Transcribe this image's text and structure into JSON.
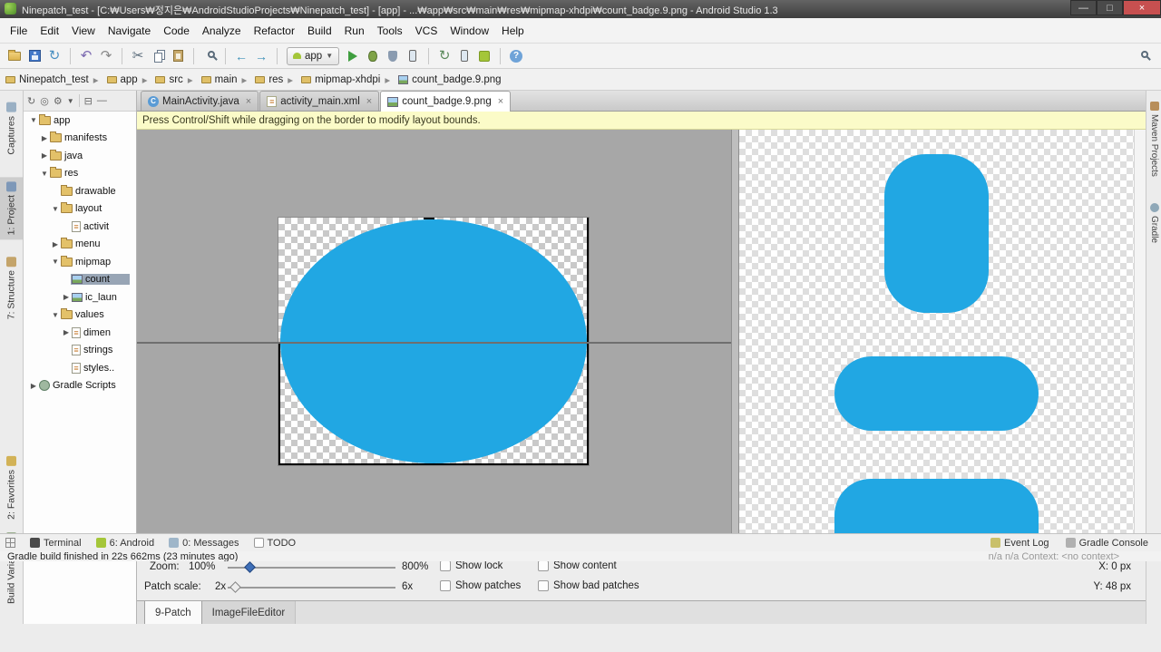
{
  "window": {
    "title": "Ninepatch_test - [C:₩Users₩정지은₩AndroidStudioProjects₩Ninepatch_test] - [app] - ...₩app₩src₩main₩res₩mipmap-xhdpi₩count_badge.9.png - Android Studio 1.3",
    "controls": {
      "minimize": "—",
      "maximize": "□",
      "close": "×"
    }
  },
  "menu": {
    "items": [
      "File",
      "Edit",
      "View",
      "Navigate",
      "Code",
      "Analyze",
      "Refactor",
      "Build",
      "Run",
      "Tools",
      "VCS",
      "Window",
      "Help"
    ]
  },
  "toolbar": {
    "run_config_label": "app"
  },
  "breadcrumbs": {
    "items": [
      "Ninepatch_test",
      "app",
      "src",
      "main",
      "res",
      "mipmap-xhdpi",
      "count_badge.9.png"
    ]
  },
  "left_stripe": {
    "items": [
      "Captures",
      "1: Project",
      "7: Structure",
      "2: Favorites",
      "Build Variants"
    ]
  },
  "right_stripe": {
    "items": [
      "Maven Projects",
      "Gradle"
    ]
  },
  "project": {
    "rows": [
      {
        "arrow": "▼",
        "label": "app"
      },
      {
        "arrow": "▶",
        "label": "manifests"
      },
      {
        "arrow": "▶",
        "label": "java"
      },
      {
        "arrow": "▼",
        "label": "res"
      },
      {
        "arrow": "",
        "label": "drawable"
      },
      {
        "arrow": "▼",
        "label": "layout"
      },
      {
        "arrow": "",
        "label": "activit"
      },
      {
        "arrow": "▶",
        "label": "menu"
      },
      {
        "arrow": "▼",
        "label": "mipmap"
      },
      {
        "arrow": "",
        "label": "count"
      },
      {
        "arrow": "▶",
        "label": "ic_laun"
      },
      {
        "arrow": "▼",
        "label": "values"
      },
      {
        "arrow": "▶",
        "label": "dimen"
      },
      {
        "arrow": "",
        "label": "strings"
      },
      {
        "arrow": "",
        "label": "styles.."
      },
      {
        "arrow": "▶",
        "label": "Gradle Scripts"
      }
    ]
  },
  "editor": {
    "tabs": [
      {
        "label": "MainActivity.java",
        "close": "×"
      },
      {
        "label": "activity_main.xml",
        "close": "×"
      },
      {
        "label": "count_badge.9.png",
        "close": "×"
      }
    ],
    "banner": "Press Control/Shift while dragging on the border to modify layout bounds."
  },
  "controls": {
    "zoom_label": "Zoom:",
    "zoom_value": "100%",
    "zoom_max": "800%",
    "patch_label": "Patch scale:",
    "patch_value": "2x",
    "patch_max": "6x",
    "show_lock": "Show lock",
    "show_content": "Show content",
    "show_patches": "Show patches",
    "show_bad_patches": "Show bad patches",
    "x_readout": "X:  0 px",
    "y_readout": "Y: 48 px"
  },
  "bottom_tabs": {
    "items": [
      "9-Patch",
      "ImageFileEditor"
    ]
  },
  "statusbar": {
    "left": [
      "Terminal",
      "6: Android",
      "0: Messages",
      "TODO"
    ],
    "right": [
      "Event Log",
      "Gradle Console"
    ],
    "message": "Gradle build finished in 22s 662ms (23 minutes ago)",
    "position_info": "n/a        n/a        Context: <no context>"
  },
  "colors": {
    "badge_blue": "#21A7E3",
    "banner_bg": "#FBFBC8",
    "close_button": "#C75050",
    "android_green": "#A4C639",
    "canvas_gray": "#A7A7A7"
  }
}
